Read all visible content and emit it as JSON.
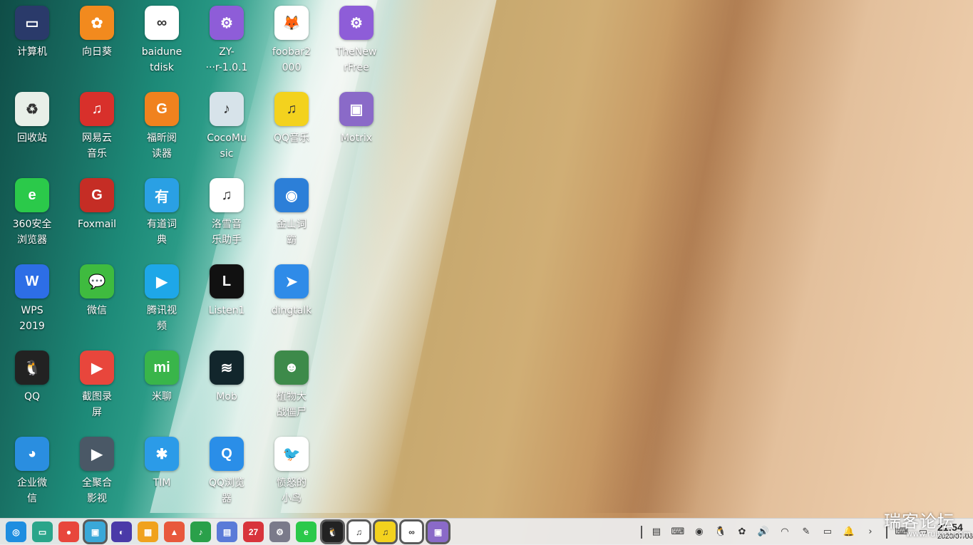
{
  "desktop": {
    "icons": [
      {
        "label": "计算机",
        "icon": "computer-icon",
        "color": "#2a3a6a",
        "glyph": "▭"
      },
      {
        "label": "回收站",
        "icon": "recycle-bin-icon",
        "color": "#e8efe8",
        "glyph": "♻"
      },
      {
        "label": "360安全\n浏览器",
        "icon": "360-browser-icon",
        "color": "#2bc94a",
        "glyph": "e"
      },
      {
        "label": "WPS\n2019",
        "icon": "wps-icon",
        "color": "#2d6ee6",
        "glyph": "W"
      },
      {
        "label": "QQ",
        "icon": "qq-icon",
        "color": "#222222",
        "glyph": "🐧"
      },
      {
        "label": "企业微\n信",
        "icon": "wecom-icon",
        "color": "#2a8ee0",
        "glyph": "◕"
      },
      {
        "label": "向日葵",
        "icon": "sunflower-icon",
        "color": "#f28a1e",
        "glyph": "✿"
      },
      {
        "label": "网易云\n音乐",
        "icon": "netease-music-icon",
        "color": "#d8302b",
        "glyph": "♫"
      },
      {
        "label": "Foxmail",
        "icon": "foxmail-icon",
        "color": "#c52d25",
        "glyph": "G"
      },
      {
        "label": "微信",
        "icon": "wechat-icon",
        "color": "#3fbb3f",
        "glyph": "💬"
      },
      {
        "label": "截图录\n屏",
        "icon": "screenshot-icon",
        "color": "#e8463c",
        "glyph": "▶"
      },
      {
        "label": "全聚合\n影视",
        "icon": "video-aggregator-icon",
        "color": "#4a5866",
        "glyph": "▶"
      },
      {
        "label": "baidune\ntdisk",
        "icon": "baidu-netdisk-icon",
        "color": "#ffffff",
        "glyph": "∞"
      },
      {
        "label": "福昕阅\n读器",
        "icon": "foxit-reader-icon",
        "color": "#f0821e",
        "glyph": "G"
      },
      {
        "label": "有道词\n典",
        "icon": "youdao-dict-icon",
        "color": "#2aa0e4",
        "glyph": "有"
      },
      {
        "label": "腾讯视\n频",
        "icon": "tencent-video-icon",
        "color": "#1ea7e8",
        "glyph": "▶"
      },
      {
        "label": "米聊",
        "icon": "miliao-icon",
        "color": "#39b54a",
        "glyph": "mi"
      },
      {
        "label": "TIM",
        "icon": "tim-icon",
        "color": "#2b9be8",
        "glyph": "✱"
      },
      {
        "label": "ZY-\n···r-1.0.1",
        "icon": "zy-app-icon",
        "color": "#8e5dd8",
        "glyph": "⚙"
      },
      {
        "label": "CocoMu\nsic",
        "icon": "cocomusic-icon",
        "color": "#d7e3ea",
        "glyph": "♪"
      },
      {
        "label": "洛雪音\n乐助手",
        "icon": "lx-music-icon",
        "color": "#ffffff",
        "glyph": "♫"
      },
      {
        "label": "Listen1",
        "icon": "listen1-icon",
        "color": "#111111",
        "glyph": "L"
      },
      {
        "label": "Mob",
        "icon": "mob-icon",
        "color": "#12262c",
        "glyph": "≋"
      },
      {
        "label": "QQ浏览\n器",
        "icon": "qq-browser-icon",
        "color": "#2a8ee8",
        "glyph": "Q"
      },
      {
        "label": "foobar2\n000",
        "icon": "foobar2000-icon",
        "color": "#ffffff",
        "glyph": "🦊"
      },
      {
        "label": "QQ音乐",
        "icon": "qq-music-icon",
        "color": "#f3d21e",
        "glyph": "♫"
      },
      {
        "label": "金山词\n霸",
        "icon": "jinshan-ciba-icon",
        "color": "#2c7fd8",
        "glyph": "◉"
      },
      {
        "label": "dingtalk",
        "icon": "dingtalk-icon",
        "color": "#2f8be8",
        "glyph": "➤"
      },
      {
        "label": "植物大\n战僵尸",
        "icon": "pvz-icon",
        "color": "#3d8a4a",
        "glyph": "☻"
      },
      {
        "label": "愤怒的\n小鸟",
        "icon": "angry-birds-icon",
        "color": "#ffffff",
        "glyph": "🐦"
      },
      {
        "label": "TheNew\nrFree",
        "icon": "thenewrfree-icon",
        "color": "#8e5dd8",
        "glyph": "⚙"
      },
      {
        "label": "Motrix",
        "icon": "motrix-icon",
        "color": "#8a6ac8",
        "glyph": "▣"
      }
    ]
  },
  "taskbar": {
    "apps": [
      {
        "name": "launcher-icon",
        "color": "#1e8ee0",
        "glyph": "◎",
        "active": false
      },
      {
        "name": "terminal-icon",
        "color": "#2aa58a",
        "glyph": "▭",
        "active": false
      },
      {
        "name": "screen-recorder-icon",
        "color": "#e8463c",
        "glyph": "●",
        "active": false
      },
      {
        "name": "app-store-icon",
        "color": "#3aa8d8",
        "glyph": "▣",
        "active": true
      },
      {
        "name": "browser-icon",
        "color": "#4a3aa8",
        "glyph": "◐",
        "active": false
      },
      {
        "name": "shop-icon",
        "color": "#f0a21e",
        "glyph": "▦",
        "active": false
      },
      {
        "name": "image-viewer-icon",
        "color": "#e8583c",
        "glyph": "▲",
        "active": false
      },
      {
        "name": "music-player-icon",
        "color": "#2aa04a",
        "glyph": "♪",
        "active": false
      },
      {
        "name": "document-viewer-icon",
        "color": "#5a7ad8",
        "glyph": "▤",
        "active": false
      },
      {
        "name": "calendar-icon",
        "color": "#d8343c",
        "glyph": "27",
        "active": false
      },
      {
        "name": "settings-icon",
        "color": "#7a7a8a",
        "glyph": "⚙",
        "active": false
      },
      {
        "name": "360-browser-task-icon",
        "color": "#2bc94a",
        "glyph": "e",
        "active": false
      },
      {
        "name": "qq-task-icon",
        "color": "#222222",
        "glyph": "🐧",
        "active": true
      },
      {
        "name": "lx-music-task-icon",
        "color": "#ffffff",
        "glyph": "♫",
        "active": true
      },
      {
        "name": "qq-music-task-icon",
        "color": "#f3d21e",
        "glyph": "♫",
        "active": true
      },
      {
        "name": "baidu-netdisk-task-icon",
        "color": "#ffffff",
        "glyph": "∞",
        "active": true
      },
      {
        "name": "motrix-task-icon",
        "color": "#8a6ac8",
        "glyph": "▣",
        "active": true
      }
    ],
    "tray": [
      {
        "name": "clipboard-icon",
        "glyph": "▤"
      },
      {
        "name": "keyboard-layout-icon",
        "glyph": "⌨"
      },
      {
        "name": "qq-music-tray-icon",
        "glyph": "◉"
      },
      {
        "name": "qq-tray-icon",
        "glyph": "🐧"
      },
      {
        "name": "sunflower-tray-icon",
        "glyph": "✿"
      },
      {
        "name": "volume-icon",
        "glyph": "🔊"
      },
      {
        "name": "wifi-icon",
        "glyph": "◠"
      },
      {
        "name": "pen-icon",
        "glyph": "✎"
      },
      {
        "name": "battery-icon",
        "glyph": "▭"
      },
      {
        "name": "notification-bell-icon",
        "glyph": "🔔"
      },
      {
        "name": "expand-tray-chevron-icon",
        "glyph": "›"
      }
    ],
    "tray_right": [
      {
        "name": "onscreen-keyboard-icon",
        "glyph": "⌨"
      },
      {
        "name": "show-desktop-icon",
        "glyph": "▭"
      }
    ],
    "clock": {
      "time": "21:54",
      "date": "2020/07/06"
    }
  },
  "watermark": {
    "title": "瑞客论坛",
    "url": "www.ruike1.com"
  }
}
